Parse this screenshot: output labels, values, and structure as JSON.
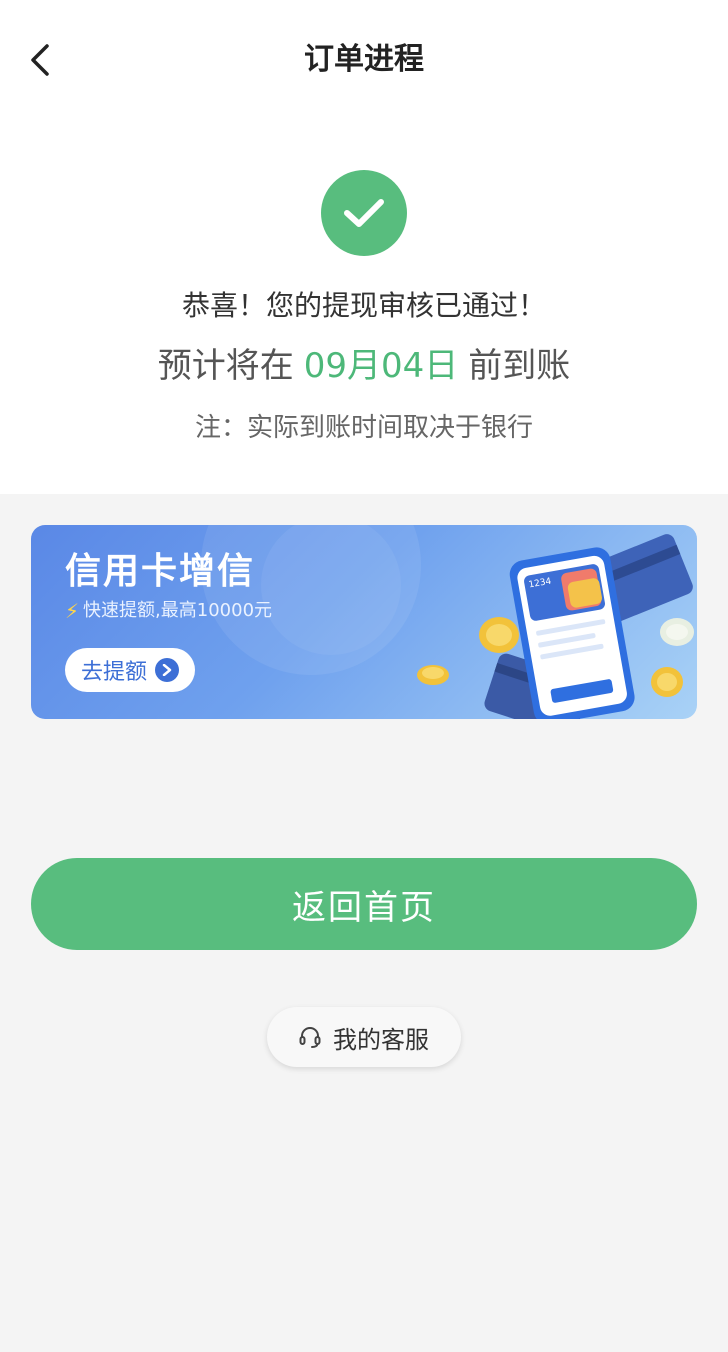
{
  "header": {
    "title": "订单进程"
  },
  "result": {
    "message": "恭喜！您的提现审核已通过！",
    "eta_prefix": "预计将在",
    "eta_date": "09月04日",
    "eta_suffix": "前到账",
    "note": "注：实际到账时间取决于银行"
  },
  "banner": {
    "title": "信用卡增信",
    "subtitle": "快速提额,最高10000元",
    "button_label": "去提额",
    "card_number": "1234"
  },
  "actions": {
    "home_label": "返回首页",
    "service_label": "我的客服"
  },
  "colors": {
    "accent_green": "#58bd7e",
    "date_green": "#4db879",
    "banner_blue": "#5a88e6"
  },
  "icons": {
    "back": "chevron-left-icon",
    "success": "checkmark-circle-icon",
    "service": "headset-icon",
    "banner_arrow": "chevron-right-icon"
  }
}
